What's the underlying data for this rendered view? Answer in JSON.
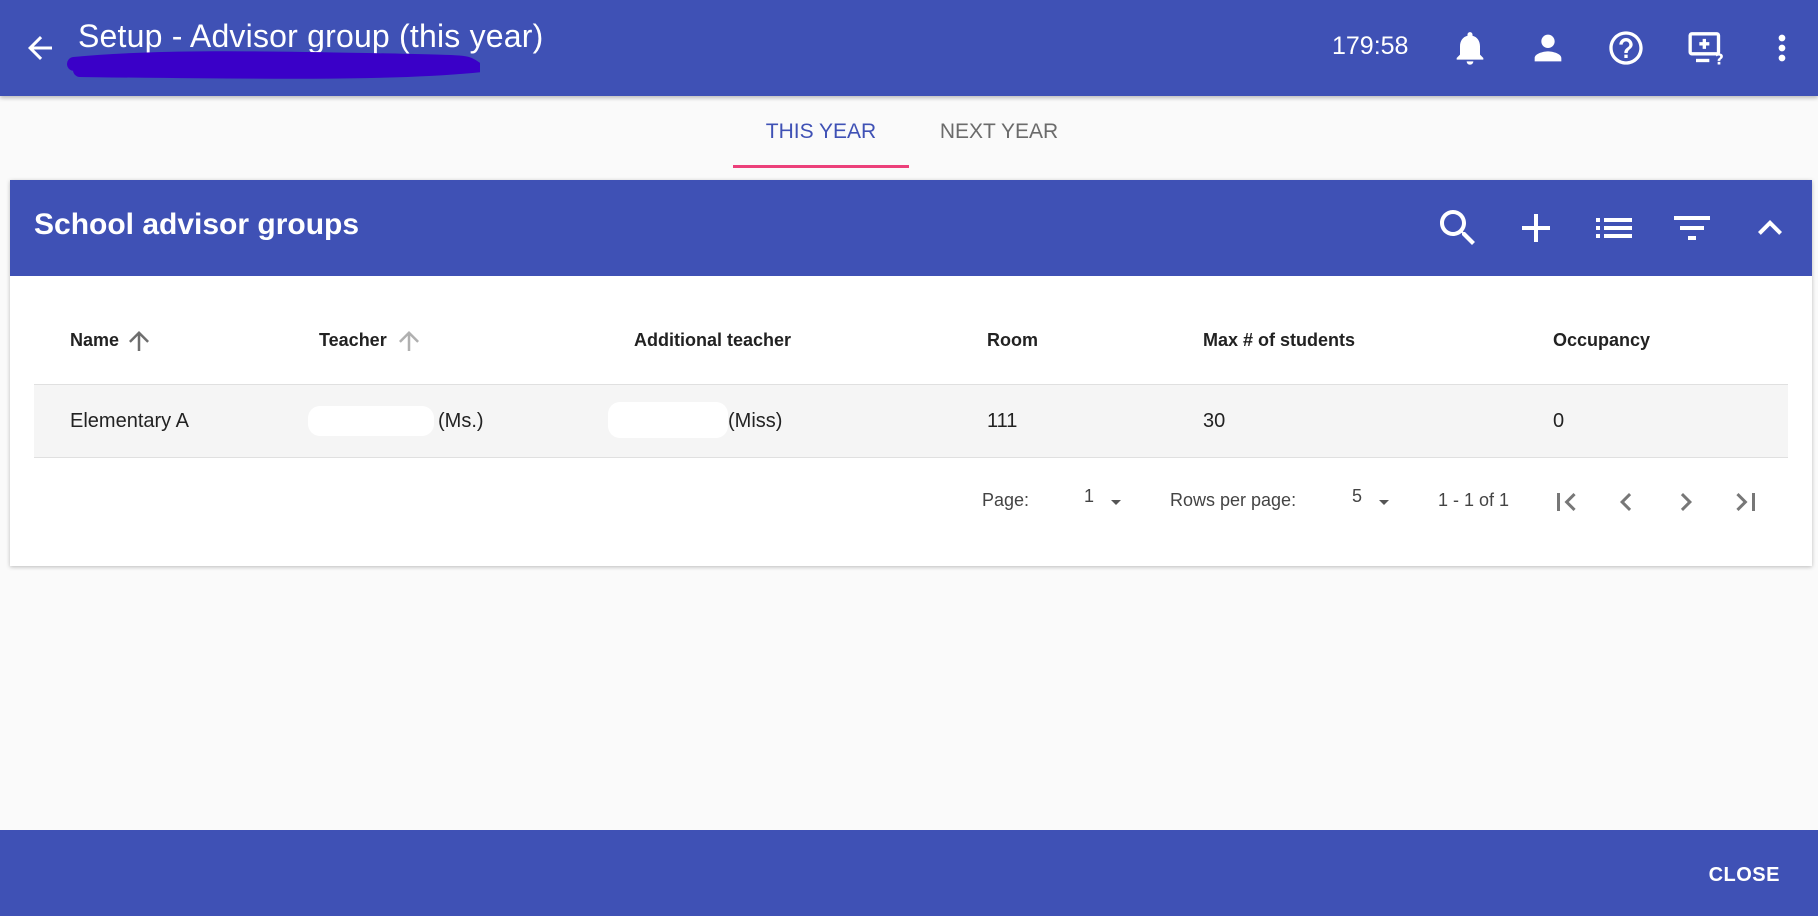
{
  "header": {
    "title": "Setup - Advisor group (this year)",
    "timer": "179:58",
    "icons": [
      "arrow-back-icon",
      "bell-icon",
      "person-icon",
      "help-icon",
      "screen-help-icon",
      "more-vert-icon"
    ]
  },
  "tabs": [
    {
      "label": "THIS YEAR",
      "active": true
    },
    {
      "label": "NEXT YEAR",
      "active": false
    }
  ],
  "card": {
    "title": "School advisor groups",
    "tool_icons": [
      "search-icon",
      "add-icon",
      "list-icon",
      "filter-icon",
      "collapse-icon"
    ]
  },
  "table": {
    "columns": [
      "Name",
      "Teacher",
      "Additional teacher",
      "Room",
      "Max # of students",
      "Occupancy"
    ],
    "rows": [
      {
        "name": "Elementary A",
        "teacher": "(Ms.)",
        "additional_teacher": "(Miss)",
        "room": "111",
        "max_students": "30",
        "occupancy": "0"
      }
    ]
  },
  "pagination": {
    "page_label": "Page:",
    "page_value": "1",
    "rows_label": "Rows per page:",
    "rows_value": "5",
    "range": "1 - 1 of 1"
  },
  "footer": {
    "close_label": "CLOSE"
  },
  "colors": {
    "primary": "#3f51b5",
    "tab_indicator": "#ec407a",
    "background": "#fafafa"
  }
}
